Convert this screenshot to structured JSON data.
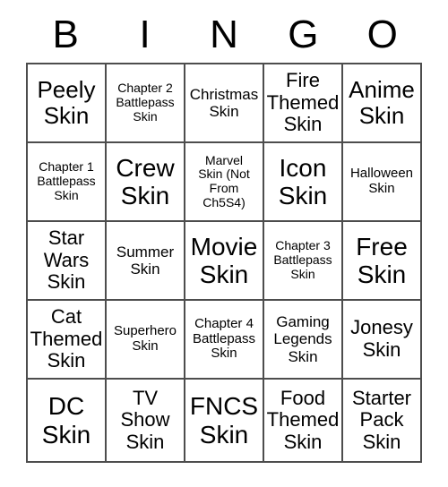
{
  "card": {
    "title": "BINGO",
    "headers": [
      "B",
      "I",
      "N",
      "G",
      "O"
    ],
    "rows": [
      [
        {
          "text": "Peely\nSkin",
          "size": "sz-lg"
        },
        {
          "text": "Chapter 2\nBattlepass\nSkin",
          "size": "sz-xxs"
        },
        {
          "text": "Christmas\nSkin",
          "size": "sz-sm"
        },
        {
          "text": "Fire\nThemed\nSkin",
          "size": "sz-md"
        },
        {
          "text": "Anime\nSkin",
          "size": "sz-lg"
        }
      ],
      [
        {
          "text": "Chapter 1\nBattlepass\nSkin",
          "size": "sz-xxs"
        },
        {
          "text": "Crew\nSkin",
          "size": "sz-xl"
        },
        {
          "text": "Marvel\nSkin (Not\nFrom\nCh5S4)",
          "size": "sz-xxs"
        },
        {
          "text": "Icon\nSkin",
          "size": "sz-xl"
        },
        {
          "text": "Halloween\nSkin",
          "size": "sz-xs"
        }
      ],
      [
        {
          "text": "Star\nWars\nSkin",
          "size": "sz-md"
        },
        {
          "text": "Summer\nSkin",
          "size": "sz-sm"
        },
        {
          "text": "Movie\nSkin",
          "size": "sz-xl"
        },
        {
          "text": "Chapter 3\nBattlepass\nSkin",
          "size": "sz-xxs"
        },
        {
          "text": "Free\nSkin",
          "size": "sz-xl"
        }
      ],
      [
        {
          "text": "Cat\nThemed\nSkin",
          "size": "sz-md"
        },
        {
          "text": "Superhero\nSkin",
          "size": "sz-xs"
        },
        {
          "text": "Chapter 4\nBattlepass\nSkin",
          "size": "sz-xs"
        },
        {
          "text": "Gaming\nLegends\nSkin",
          "size": "sz-sm"
        },
        {
          "text": "Jonesy\nSkin",
          "size": "sz-md"
        }
      ],
      [
        {
          "text": "DC\nSkin",
          "size": "sz-xl"
        },
        {
          "text": "TV\nShow\nSkin",
          "size": "sz-md"
        },
        {
          "text": "FNCS\nSkin",
          "size": "sz-xl"
        },
        {
          "text": "Food\nThemed\nSkin",
          "size": "sz-md"
        },
        {
          "text": "Starter\nPack\nSkin",
          "size": "sz-md"
        }
      ]
    ]
  },
  "colors": {
    "border": "#4d4d4d",
    "text": "#000000",
    "background": "#ffffff"
  }
}
